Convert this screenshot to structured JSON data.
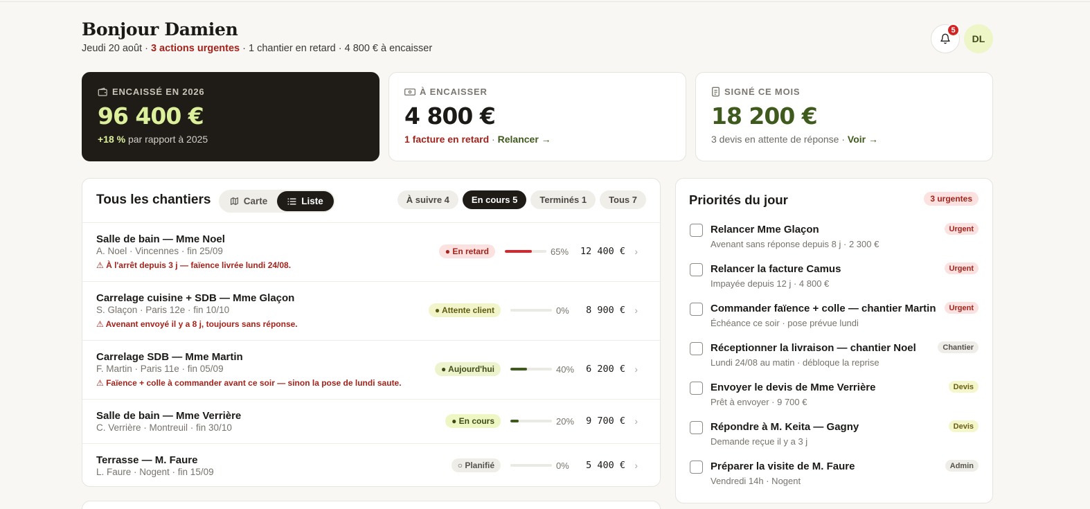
{
  "header": {
    "greeting": "Bonjour Damien",
    "date": "Jeudi 20 août",
    "sep1": " · ",
    "urgent": "3 actions urgentes",
    "rest": " · 1 chantier en retard · 4 800 € à encaisser",
    "notif_count": "5",
    "avatar_initials": "DL"
  },
  "kpis": {
    "encaisse": {
      "label": "ENCAISSÉ EN 2026",
      "value": "96 400 €",
      "delta": "+18 %",
      "note": " par rapport à 2025"
    },
    "a_encaisser": {
      "label": "À ENCAISSER",
      "value": "4 800 €",
      "late": "1 facture en retard",
      "sep": " · ",
      "action": "Relancer →"
    },
    "signe": {
      "label": "SIGNÉ CE MOIS",
      "value": "18 200 €",
      "note": "3 devis en attente de réponse · ",
      "action": "Voir →"
    }
  },
  "chantiers": {
    "title": "Tous les chantiers",
    "views": {
      "map": "Carte",
      "list": "Liste"
    },
    "filters": [
      "À suivre 4",
      "En cours 5",
      "Terminés 1",
      "Tous 7"
    ],
    "rows": [
      {
        "title": "Salle de bain — Mme Noel",
        "meta": "A. Noel · Vincennes · fin 25/09",
        "alert": "⚠ À l'arrêt depuis 3 j — faïence livrée lundi 24/08.",
        "status": "● En retard",
        "progress": 65,
        "pct": "65%",
        "amount": "12 400 €"
      },
      {
        "title": "Carrelage cuisine + SDB — Mme Glaçon",
        "meta": "S. Glaçon · Paris 12e · fin 10/10",
        "alert": "⚠ Avenant envoyé il y a 8 j, toujours sans réponse.",
        "status": "● Attente client",
        "progress": 0,
        "pct": "0%",
        "amount": "8 900 €"
      },
      {
        "title": "Carrelage SDB — Mme Martin",
        "meta": "F. Martin · Paris 11e · fin 05/09",
        "alert": "⚠ Faïence + colle à commander avant ce soir — sinon la pose de lundi saute.",
        "status": "● Aujourd'hui",
        "progress": 40,
        "pct": "40%",
        "amount": "6 200 €"
      },
      {
        "title": "Salle de bain — Mme Verrière",
        "meta": "C. Verrière · Montreuil · fin 30/10",
        "alert": "",
        "status": "● En cours",
        "progress": 20,
        "pct": "20%",
        "amount": "9 700 €"
      },
      {
        "title": "Terrasse — M. Faure",
        "meta": "L. Faure · Nogent · fin 15/09",
        "alert": "",
        "status": "○ Planifié",
        "progress": 0,
        "pct": "0%",
        "amount": "5 400 €"
      }
    ],
    "chevron": "›"
  },
  "priorities": {
    "title": "Priorités du jour",
    "count": "3 urgentes",
    "tasks": [
      {
        "title": "Relancer Mme Glaçon",
        "meta": "Avenant sans réponse depuis 8 j · 2 300 €",
        "tag": "Urgent"
      },
      {
        "title": "Relancer la facture Camus",
        "meta": "Impayée depuis 12 j · 4 800 €",
        "tag": "Urgent"
      },
      {
        "title": "Commander faïence + colle — chantier Martin",
        "meta": "Échéance ce soir · pose prévue lundi",
        "tag": "Urgent"
      },
      {
        "title": "Réceptionner la livraison — chantier Noel",
        "meta": "Lundi 24/08 au matin · débloque la reprise",
        "tag": "Chantier"
      },
      {
        "title": "Envoyer le devis de Mme Verrière",
        "meta": "Prêt à envoyer · 9 700 €",
        "tag": "Devis"
      },
      {
        "title": "Répondre à M. Keita — Gagny",
        "meta": "Demande reçue il y a 3 j",
        "tag": "Devis"
      },
      {
        "title": "Préparer la visite de M. Faure",
        "meta": "Vendredi 14h · Nogent",
        "tag": "Admin"
      }
    ]
  },
  "colors": {
    "progress_late": "#d9262c",
    "progress_ok": "#3e5a1c",
    "accent_lime": "#dcef9a",
    "urgent_red": "#a4231b"
  }
}
